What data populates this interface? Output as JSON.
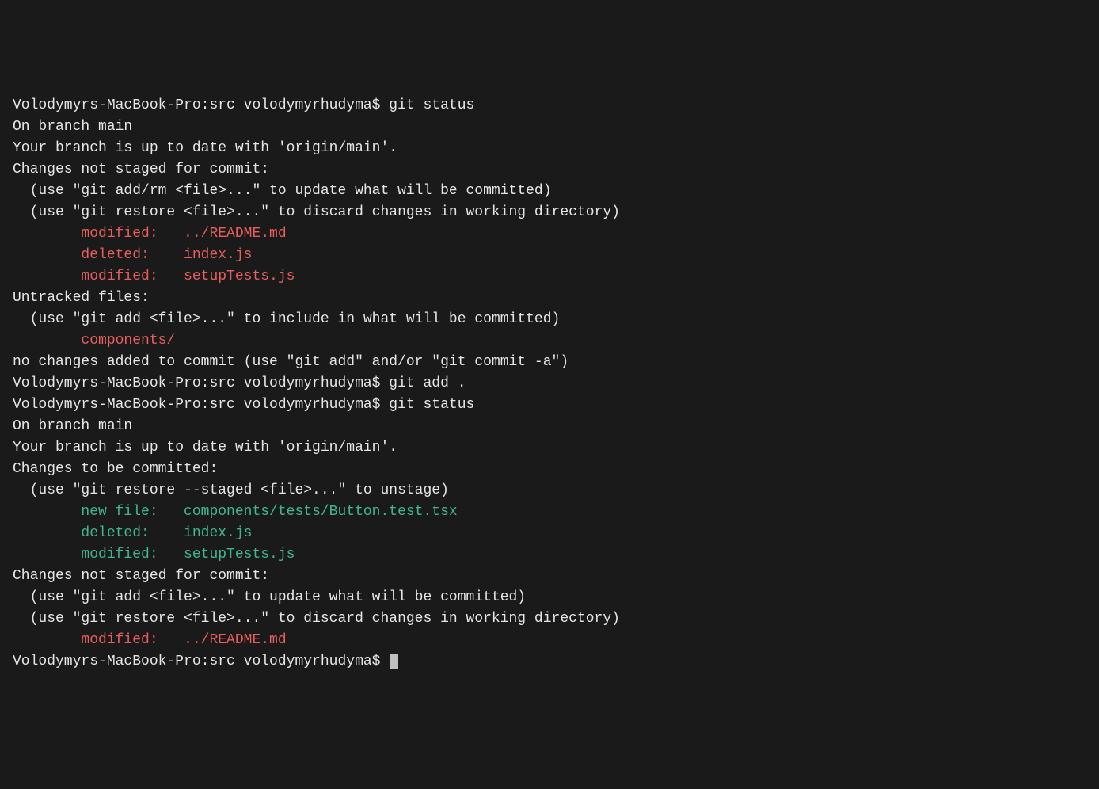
{
  "lines": [
    {
      "segments": [
        {
          "text": "Volodymyrs-MacBook-Pro:src volodymyrhudyma$ git status",
          "cls": ""
        }
      ]
    },
    {
      "segments": [
        {
          "text": "On branch main",
          "cls": ""
        }
      ]
    },
    {
      "segments": [
        {
          "text": "Your branch is up to date with 'origin/main'.",
          "cls": ""
        }
      ]
    },
    {
      "segments": [
        {
          "text": "",
          "cls": ""
        }
      ]
    },
    {
      "segments": [
        {
          "text": "Changes not staged for commit:",
          "cls": ""
        }
      ]
    },
    {
      "segments": [
        {
          "text": "  (use \"git add/rm <file>...\" to update what will be committed)",
          "cls": ""
        }
      ]
    },
    {
      "segments": [
        {
          "text": "  (use \"git restore <file>...\" to discard changes in working directory)",
          "cls": ""
        }
      ]
    },
    {
      "segments": [
        {
          "text": "        ",
          "cls": ""
        },
        {
          "text": "modified:   ../README.md",
          "cls": "red"
        }
      ]
    },
    {
      "segments": [
        {
          "text": "        ",
          "cls": ""
        },
        {
          "text": "deleted:    index.js",
          "cls": "red"
        }
      ]
    },
    {
      "segments": [
        {
          "text": "        ",
          "cls": ""
        },
        {
          "text": "modified:   setupTests.js",
          "cls": "red"
        }
      ]
    },
    {
      "segments": [
        {
          "text": "",
          "cls": ""
        }
      ]
    },
    {
      "segments": [
        {
          "text": "Untracked files:",
          "cls": ""
        }
      ]
    },
    {
      "segments": [
        {
          "text": "  (use \"git add <file>...\" to include in what will be committed)",
          "cls": ""
        }
      ]
    },
    {
      "segments": [
        {
          "text": "        ",
          "cls": ""
        },
        {
          "text": "components/",
          "cls": "red"
        }
      ]
    },
    {
      "segments": [
        {
          "text": "",
          "cls": ""
        }
      ]
    },
    {
      "segments": [
        {
          "text": "no changes added to commit (use \"git add\" and/or \"git commit -a\")",
          "cls": ""
        }
      ]
    },
    {
      "segments": [
        {
          "text": "Volodymyrs-MacBook-Pro:src volodymyrhudyma$ git add .",
          "cls": ""
        }
      ]
    },
    {
      "segments": [
        {
          "text": "Volodymyrs-MacBook-Pro:src volodymyrhudyma$ git status",
          "cls": ""
        }
      ]
    },
    {
      "segments": [
        {
          "text": "On branch main",
          "cls": ""
        }
      ]
    },
    {
      "segments": [
        {
          "text": "Your branch is up to date with 'origin/main'.",
          "cls": ""
        }
      ]
    },
    {
      "segments": [
        {
          "text": "",
          "cls": ""
        }
      ]
    },
    {
      "segments": [
        {
          "text": "Changes to be committed:",
          "cls": ""
        }
      ]
    },
    {
      "segments": [
        {
          "text": "  (use \"git restore --staged <file>...\" to unstage)",
          "cls": ""
        }
      ]
    },
    {
      "segments": [
        {
          "text": "        ",
          "cls": ""
        },
        {
          "text": "new file:   components/tests/Button.test.tsx",
          "cls": "green"
        }
      ]
    },
    {
      "segments": [
        {
          "text": "        ",
          "cls": ""
        },
        {
          "text": "deleted:    index.js",
          "cls": "green"
        }
      ]
    },
    {
      "segments": [
        {
          "text": "        ",
          "cls": ""
        },
        {
          "text": "modified:   setupTests.js",
          "cls": "green"
        }
      ]
    },
    {
      "segments": [
        {
          "text": "",
          "cls": ""
        }
      ]
    },
    {
      "segments": [
        {
          "text": "Changes not staged for commit:",
          "cls": ""
        }
      ]
    },
    {
      "segments": [
        {
          "text": "  (use \"git add <file>...\" to update what will be committed)",
          "cls": ""
        }
      ]
    },
    {
      "segments": [
        {
          "text": "  (use \"git restore <file>...\" to discard changes in working directory)",
          "cls": ""
        }
      ]
    },
    {
      "segments": [
        {
          "text": "        ",
          "cls": ""
        },
        {
          "text": "modified:   ../README.md",
          "cls": "red"
        }
      ]
    },
    {
      "segments": [
        {
          "text": "",
          "cls": ""
        }
      ]
    },
    {
      "segments": [
        {
          "text": "Volodymyrs-MacBook-Pro:src volodymyrhudyma$ ",
          "cls": ""
        }
      ],
      "cursor": true
    }
  ]
}
